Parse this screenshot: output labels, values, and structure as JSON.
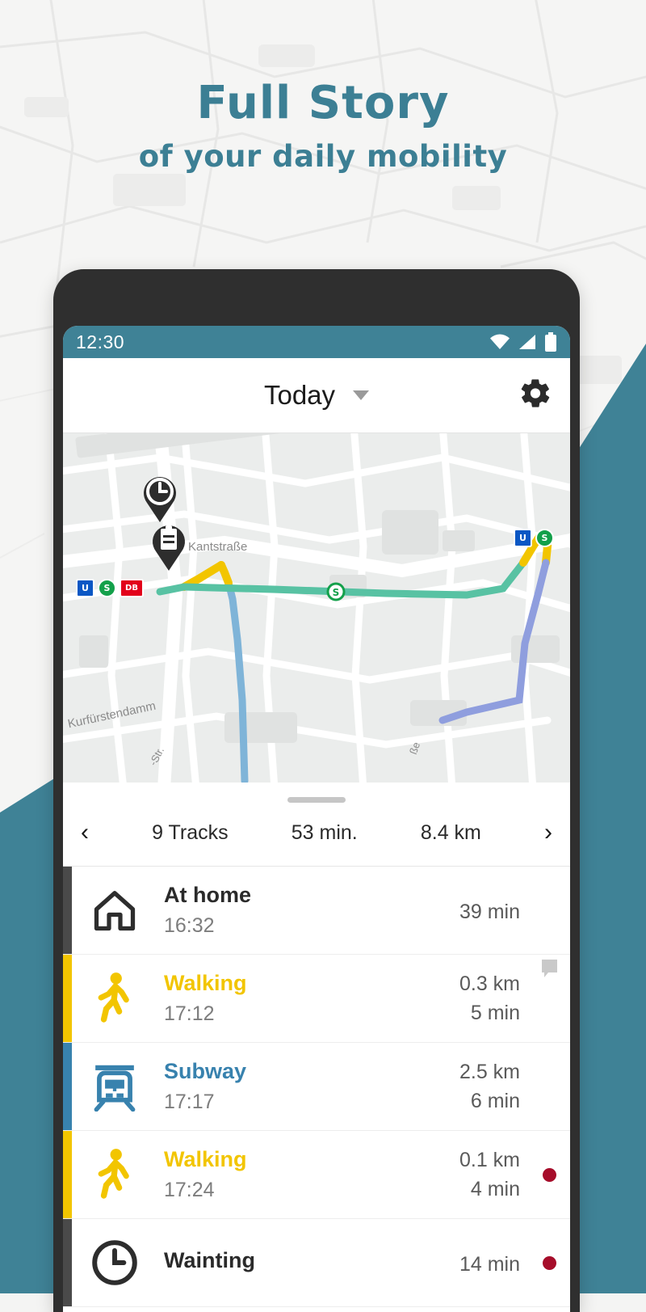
{
  "headline": {
    "line1": "Full Story",
    "line2": "of your daily mobility",
    "color": "#3c7f94"
  },
  "statusbar": {
    "time": "12:30",
    "icons": [
      "wifi-icon",
      "signal-icon",
      "battery-icon"
    ],
    "background": "#3f8296"
  },
  "appbar": {
    "title": "Today",
    "dropdown_icon": "chevron-down-icon",
    "settings_icon": "gear-icon"
  },
  "map": {
    "street_labels": [
      "Kantstraße",
      "Kurfürstendamm",
      "-Str.",
      "ße"
    ],
    "pins": [
      {
        "name": "clock-pin",
        "icon": "clock-icon"
      },
      {
        "name": "clipboard-pin",
        "icon": "clipboard-icon"
      }
    ],
    "station_badges_left": [
      {
        "type": "ubahn",
        "label": "U"
      },
      {
        "type": "sbahn",
        "label": "S"
      },
      {
        "type": "db",
        "label": "DB"
      }
    ],
    "station_badges_right": [
      {
        "type": "ubahn",
        "label": "U"
      },
      {
        "type": "sbahn",
        "label": "S"
      }
    ],
    "route_colors": {
      "walking": "#f2c500",
      "subway": "#6aa0d8",
      "sbahn": "#4fbfa0",
      "bus": "#8f9ede"
    }
  },
  "sheet": {
    "handle": "drag-handle",
    "prev_label": "‹",
    "next_label": "›",
    "stats": [
      {
        "name": "tracks",
        "value": "9 Tracks"
      },
      {
        "name": "duration",
        "value": "53 min."
      },
      {
        "name": "distance",
        "value": "8.4 km"
      }
    ]
  },
  "tracks": [
    {
      "title": "At home",
      "time": "16:32",
      "distance": "",
      "duration": "39 min",
      "icon": "home-icon",
      "color": "#2a2a2a",
      "bar_color": "#4a4a4a",
      "flag": "none"
    },
    {
      "title": "Walking",
      "time": "17:12",
      "distance": "0.3 km",
      "duration": "5 min",
      "icon": "walking-icon",
      "color": "#f2c500",
      "bar_color": "#f2c500",
      "flag": "note"
    },
    {
      "title": "Subway",
      "time": "17:17",
      "distance": "2.5 km",
      "duration": "6 min",
      "icon": "subway-icon",
      "color": "#3882ae",
      "bar_color": "#3882ae",
      "flag": "none"
    },
    {
      "title": "Walking",
      "time": "17:24",
      "distance": "0.1 km",
      "duration": "4 min",
      "icon": "walking-icon",
      "color": "#f2c500",
      "bar_color": "#f2c500",
      "flag": "dot"
    },
    {
      "title": "Wainting",
      "time": "",
      "distance": "",
      "duration": "14 min",
      "icon": "clock-icon",
      "color": "#2a2a2a",
      "bar_color": "#4a4a4a",
      "flag": "dot"
    }
  ]
}
